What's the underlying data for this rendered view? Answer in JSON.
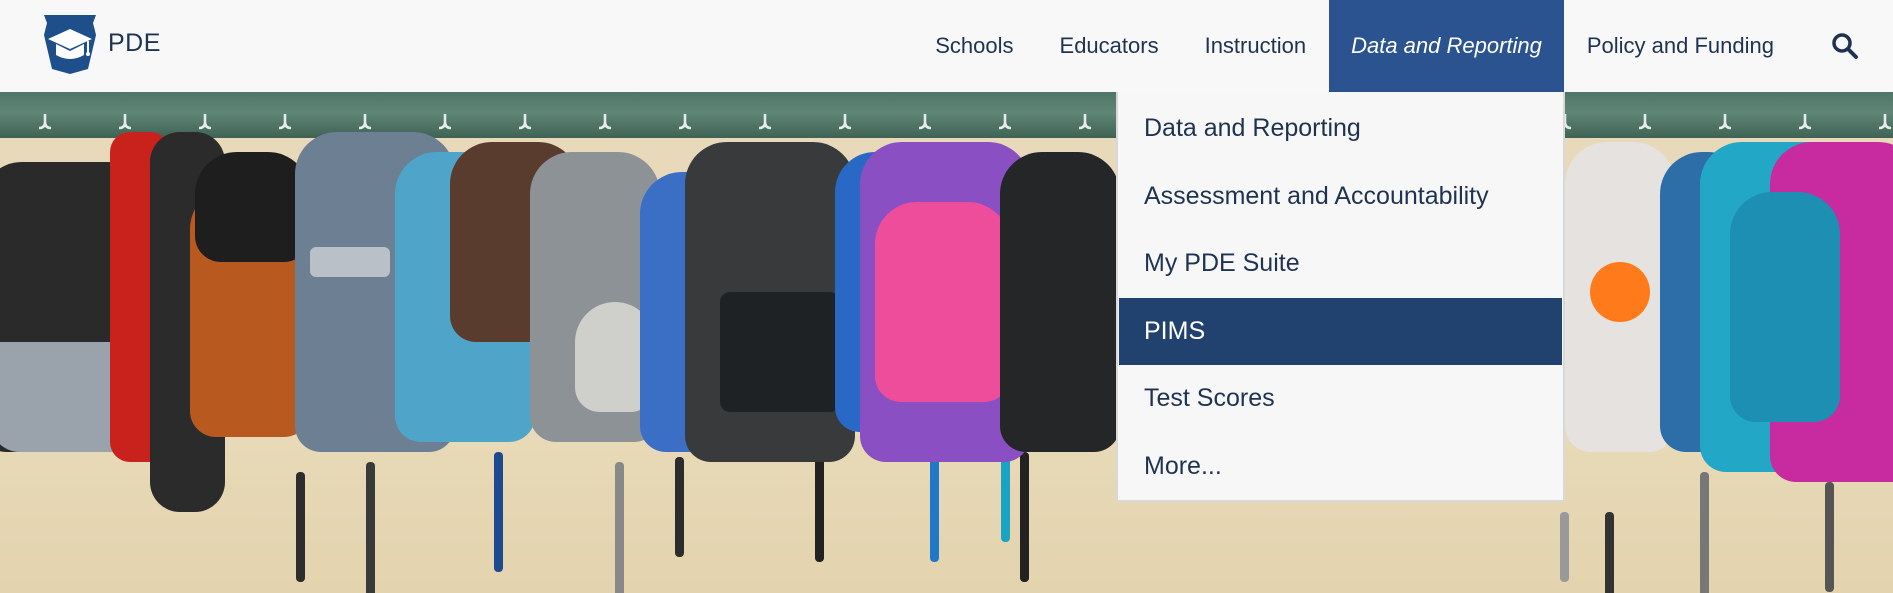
{
  "brand": {
    "name": "PDE",
    "logo_icon": "keystone-graduation-cap-icon"
  },
  "nav": {
    "items": [
      {
        "label": "Schools"
      },
      {
        "label": "Educators"
      },
      {
        "label": "Instruction"
      },
      {
        "label": "Data and Reporting",
        "active": true
      },
      {
        "label": "Policy and Funding"
      }
    ],
    "search_icon": "search-icon"
  },
  "dropdown": {
    "items": [
      {
        "label": "Data and Reporting"
      },
      {
        "label": "Assessment and Accountability"
      },
      {
        "label": "My PDE Suite"
      },
      {
        "label": "PIMS",
        "highlighted": true
      },
      {
        "label": "Test Scores"
      },
      {
        "label": "More..."
      }
    ]
  },
  "colors": {
    "nav_active": "#2a5390",
    "dropdown_highlight": "#21416f",
    "text": "#1f3350",
    "header_bg": "#f8f8f8"
  }
}
